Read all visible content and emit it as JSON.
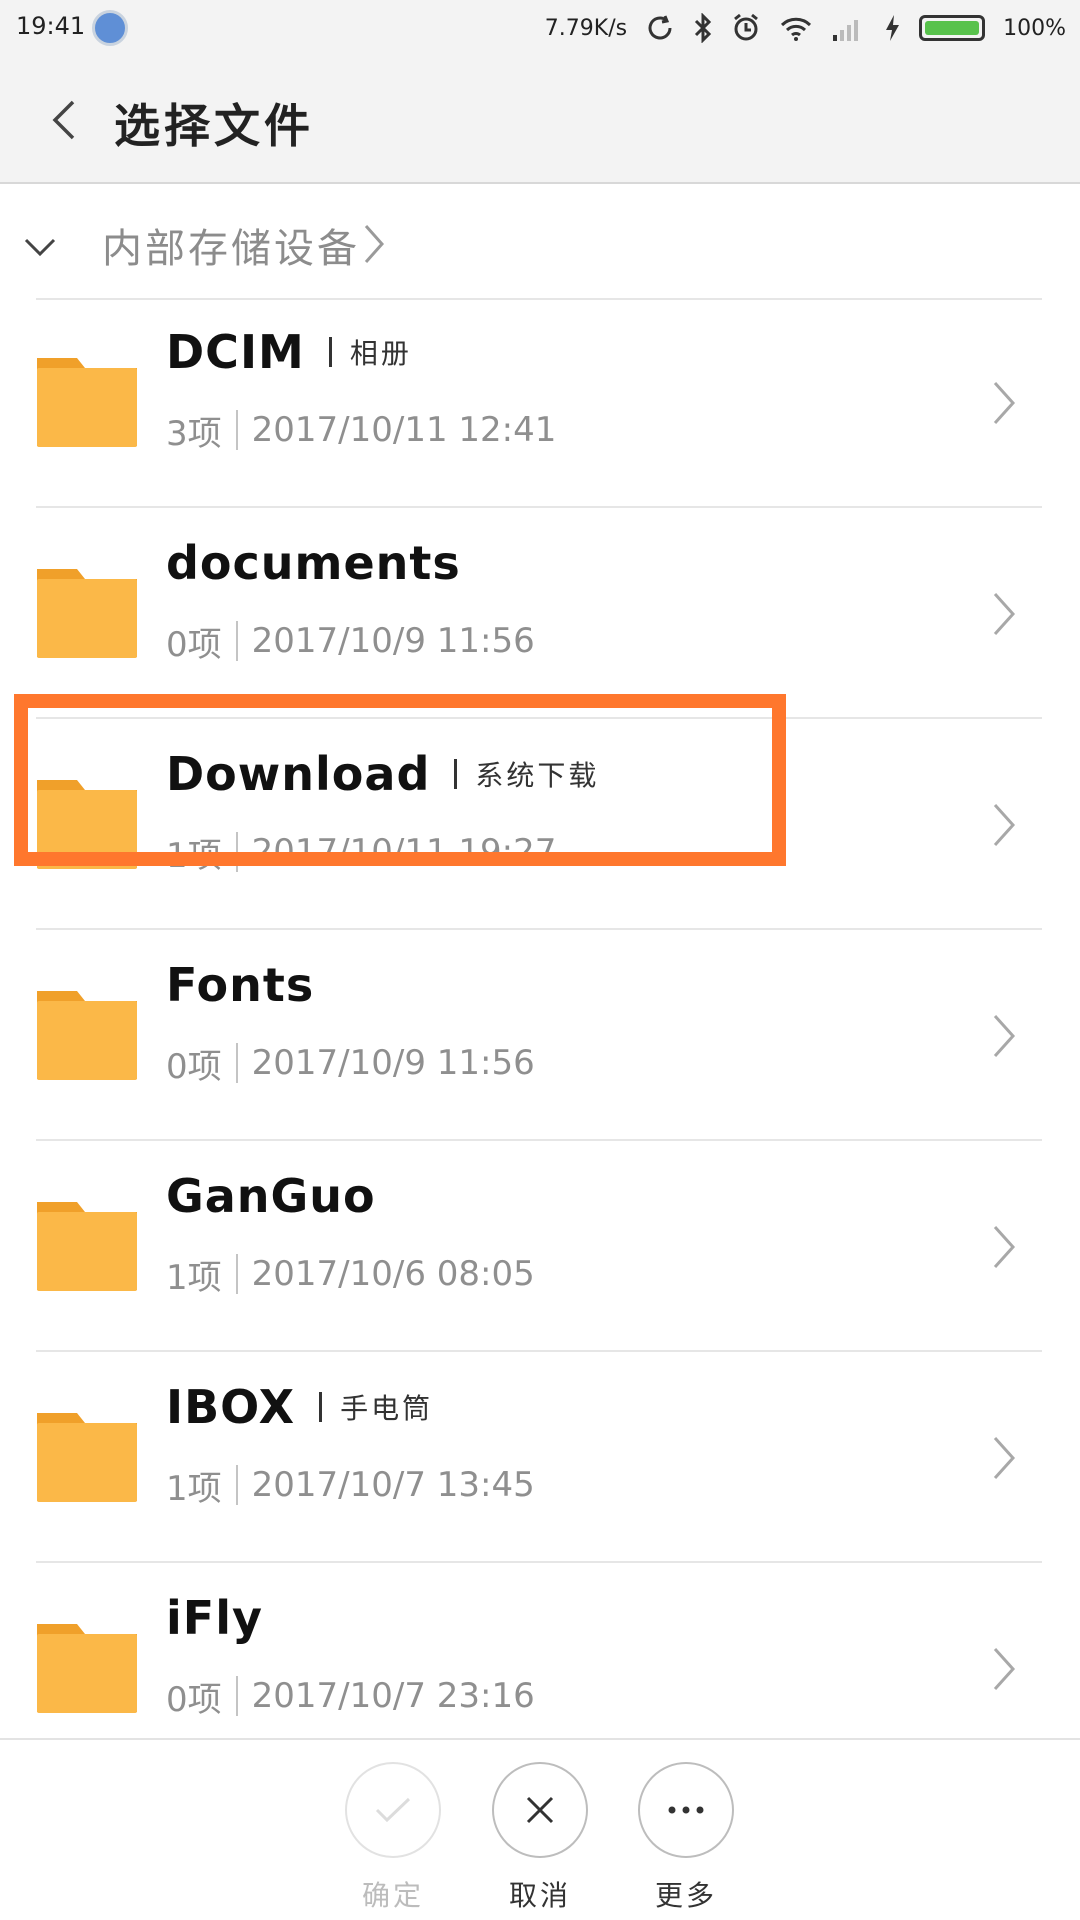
{
  "status_bar": {
    "time": "19:41",
    "net_speed": "7.79K/s",
    "battery_percent": "100%",
    "battery_level": 1.0,
    "icons": [
      "sync-icon",
      "bluetooth-icon",
      "alarm-icon",
      "wifi-icon",
      "signal-icon",
      "charging-icon",
      "battery-icon"
    ]
  },
  "header": {
    "title": "选择文件",
    "back_icon": "chevron-left-icon"
  },
  "breadcrumb": {
    "label": "内部存储设备",
    "toggle_icon": "chevron-down-icon",
    "next_icon": "chevron-right-icon"
  },
  "colors": {
    "folder": "#fbb848",
    "folder_tab": "#f0a02a",
    "highlight": "#ff772d",
    "meta_text": "#8f8f8f"
  },
  "folders": [
    {
      "name": "DCIM",
      "alias": "相册",
      "count": "3项",
      "date": "2017/10/11 12:41"
    },
    {
      "name": "documents",
      "alias": "",
      "count": "0项",
      "date": "2017/10/9 11:56"
    },
    {
      "name": "Download",
      "alias": "系统下载",
      "count": "1项",
      "date": "2017/10/11 19:27"
    },
    {
      "name": "Fonts",
      "alias": "",
      "count": "0项",
      "date": "2017/10/9 11:56"
    },
    {
      "name": "GanGuo",
      "alias": "",
      "count": "1项",
      "date": "2017/10/6 08:05"
    },
    {
      "name": "IBOX",
      "alias": "手电筒",
      "count": "1项",
      "date": "2017/10/7 13:45"
    },
    {
      "name": "iFly",
      "alias": "",
      "count": "0项",
      "date": "2017/10/7 23:16"
    }
  ],
  "bottom_actions": [
    {
      "label": "确定",
      "icon": "check-icon",
      "enabled": false
    },
    {
      "label": "取消",
      "icon": "close-icon",
      "enabled": true
    },
    {
      "label": "更多",
      "icon": "more-icon",
      "enabled": true
    }
  ]
}
